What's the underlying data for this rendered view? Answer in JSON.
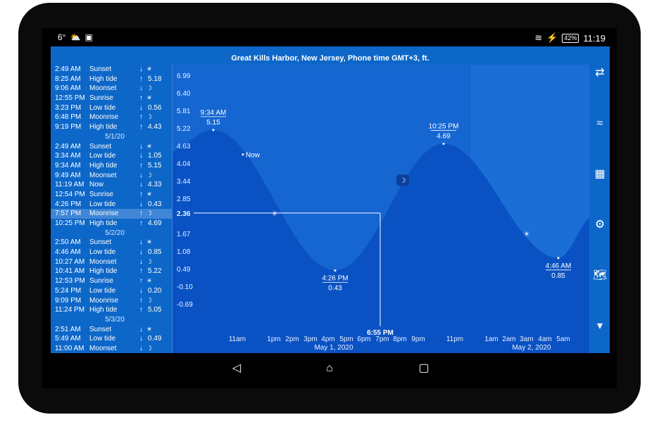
{
  "status": {
    "temperature": "6°",
    "time": "11:19",
    "battery": "42%"
  },
  "title": "Great Kills Harbor, New Jersey, Phone time GMT+3, ft.",
  "list_items": [
    {
      "type": "row",
      "time": "2:49 AM",
      "event": "Sunset",
      "arrow": "↓",
      "icon": "☀",
      "value": ""
    },
    {
      "type": "row",
      "time": "8:25 AM",
      "event": "High tide",
      "arrow": "↑",
      "icon": "",
      "value": "5.18"
    },
    {
      "type": "row",
      "time": "9:06 AM",
      "event": "Moonset",
      "arrow": "↓",
      "icon": "☽",
      "value": ""
    },
    {
      "type": "row",
      "time": "12:55 PM",
      "event": "Sunrise",
      "arrow": "↑",
      "icon": "☀",
      "value": ""
    },
    {
      "type": "row",
      "time": "3:23 PM",
      "event": "Low tide",
      "arrow": "↓",
      "icon": "",
      "value": "0.56"
    },
    {
      "type": "row",
      "time": "6:48 PM",
      "event": "Moonrise",
      "arrow": "↑",
      "icon": "☽",
      "value": ""
    },
    {
      "type": "row",
      "time": "9:19 PM",
      "event": "High tide",
      "arrow": "↑",
      "icon": "",
      "value": "4.43"
    },
    {
      "type": "date",
      "label": "5/1/20"
    },
    {
      "type": "row",
      "time": "2:49 AM",
      "event": "Sunset",
      "arrow": "↓",
      "icon": "☀",
      "value": ""
    },
    {
      "type": "row",
      "time": "3:34 AM",
      "event": "Low tide",
      "arrow": "↓",
      "icon": "",
      "value": "1.05"
    },
    {
      "type": "row",
      "time": "9:34 AM",
      "event": "High tide",
      "arrow": "↑",
      "icon": "",
      "value": "5.15"
    },
    {
      "type": "row",
      "time": "9:49 AM",
      "event": "Moonset",
      "arrow": "↓",
      "icon": "☽",
      "value": ""
    },
    {
      "type": "row",
      "time": "11:19 AM",
      "event": "Now",
      "arrow": "↓",
      "icon": "",
      "value": "4.33"
    },
    {
      "type": "row",
      "time": "12:54 PM",
      "event": "Sunrise",
      "arrow": "↑",
      "icon": "☀",
      "value": ""
    },
    {
      "type": "row",
      "time": "4:26 PM",
      "event": "Low tide",
      "arrow": "↓",
      "icon": "",
      "value": "0.43"
    },
    {
      "type": "row",
      "time": "7:57 PM",
      "event": "Moonrise",
      "arrow": "↑",
      "icon": "☽",
      "value": "",
      "selected": true
    },
    {
      "type": "row",
      "time": "10:25 PM",
      "event": "High tide",
      "arrow": "↑",
      "icon": "",
      "value": "4.69"
    },
    {
      "type": "date",
      "label": "5/2/20"
    },
    {
      "type": "row",
      "time": "2:50 AM",
      "event": "Sunset",
      "arrow": "↓",
      "icon": "☀",
      "value": ""
    },
    {
      "type": "row",
      "time": "4:46 AM",
      "event": "Low tide",
      "arrow": "↓",
      "icon": "",
      "value": "0.85"
    },
    {
      "type": "row",
      "time": "10:27 AM",
      "event": "Moonset",
      "arrow": "↓",
      "icon": "☽",
      "value": ""
    },
    {
      "type": "row",
      "time": "10:41 AM",
      "event": "High tide",
      "arrow": "↑",
      "icon": "",
      "value": "5.22"
    },
    {
      "type": "row",
      "time": "12:53 PM",
      "event": "Sunrise",
      "arrow": "↑",
      "icon": "☀",
      "value": ""
    },
    {
      "type": "row",
      "time": "5:24 PM",
      "event": "Low tide",
      "arrow": "↓",
      "icon": "",
      "value": "0.20"
    },
    {
      "type": "row",
      "time": "9:09 PM",
      "event": "Moonrise",
      "arrow": "↑",
      "icon": "☽",
      "value": ""
    },
    {
      "type": "row",
      "time": "11:24 PM",
      "event": "High tide",
      "arrow": "↑",
      "icon": "",
      "value": "5.05"
    },
    {
      "type": "date",
      "label": "5/3/20"
    },
    {
      "type": "row",
      "time": "2:51 AM",
      "event": "Sunset",
      "arrow": "↓",
      "icon": "☀",
      "value": ""
    },
    {
      "type": "row",
      "time": "5:49 AM",
      "event": "Low tide",
      "arrow": "↓",
      "icon": "",
      "value": "0.49"
    },
    {
      "type": "row",
      "time": "11:00 AM",
      "event": "Moonset",
      "arrow": "↓",
      "icon": "☽",
      "value": ""
    }
  ],
  "chart_data": {
    "type": "area",
    "y_ticks": [
      "6.99",
      "6.40",
      "5.81",
      "5.22",
      "4.63",
      "4.04",
      "3.44",
      "2.85",
      "2.36",
      "1.67",
      "1.08",
      "0.49",
      "-0.10",
      "-0.69"
    ],
    "x_ticks": [
      "11am",
      "1pm",
      "2pm",
      "3pm",
      "4pm",
      "5pm",
      "6pm",
      "7pm",
      "8pm",
      "9pm",
      "11pm",
      "1am",
      "2am",
      "3am",
      "4am",
      "5am"
    ],
    "dates": [
      "May 1, 2020",
      "May 2, 2020"
    ],
    "points": [
      {
        "time": "9:34 AM",
        "value": "5.15"
      },
      {
        "time": "4:26 PM",
        "value": "0.43"
      },
      {
        "time": "10:25 PM",
        "value": "4.69"
      },
      {
        "time": "4:46 AM",
        "value": "0.85"
      }
    ],
    "now_label": "Now",
    "cursor": {
      "value": "2.36",
      "time": "6:55 PM"
    },
    "ylim": [
      -0.69,
      6.99
    ]
  }
}
